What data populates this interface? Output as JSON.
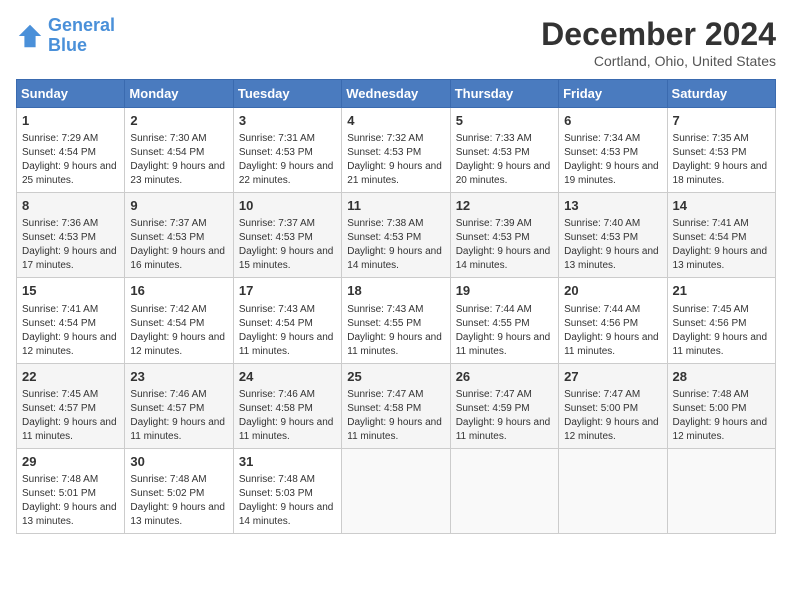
{
  "logo": {
    "line1": "General",
    "line2": "Blue"
  },
  "title": "December 2024",
  "subtitle": "Cortland, Ohio, United States",
  "days_of_week": [
    "Sunday",
    "Monday",
    "Tuesday",
    "Wednesday",
    "Thursday",
    "Friday",
    "Saturday"
  ],
  "weeks": [
    [
      {
        "day": "1",
        "sunrise": "7:29 AM",
        "sunset": "4:54 PM",
        "daylight": "9 hours and 25 minutes."
      },
      {
        "day": "2",
        "sunrise": "7:30 AM",
        "sunset": "4:54 PM",
        "daylight": "9 hours and 23 minutes."
      },
      {
        "day": "3",
        "sunrise": "7:31 AM",
        "sunset": "4:53 PM",
        "daylight": "9 hours and 22 minutes."
      },
      {
        "day": "4",
        "sunrise": "7:32 AM",
        "sunset": "4:53 PM",
        "daylight": "9 hours and 21 minutes."
      },
      {
        "day": "5",
        "sunrise": "7:33 AM",
        "sunset": "4:53 PM",
        "daylight": "9 hours and 20 minutes."
      },
      {
        "day": "6",
        "sunrise": "7:34 AM",
        "sunset": "4:53 PM",
        "daylight": "9 hours and 19 minutes."
      },
      {
        "day": "7",
        "sunrise": "7:35 AM",
        "sunset": "4:53 PM",
        "daylight": "9 hours and 18 minutes."
      }
    ],
    [
      {
        "day": "8",
        "sunrise": "7:36 AM",
        "sunset": "4:53 PM",
        "daylight": "9 hours and 17 minutes."
      },
      {
        "day": "9",
        "sunrise": "7:37 AM",
        "sunset": "4:53 PM",
        "daylight": "9 hours and 16 minutes."
      },
      {
        "day": "10",
        "sunrise": "7:37 AM",
        "sunset": "4:53 PM",
        "daylight": "9 hours and 15 minutes."
      },
      {
        "day": "11",
        "sunrise": "7:38 AM",
        "sunset": "4:53 PM",
        "daylight": "9 hours and 14 minutes."
      },
      {
        "day": "12",
        "sunrise": "7:39 AM",
        "sunset": "4:53 PM",
        "daylight": "9 hours and 14 minutes."
      },
      {
        "day": "13",
        "sunrise": "7:40 AM",
        "sunset": "4:53 PM",
        "daylight": "9 hours and 13 minutes."
      },
      {
        "day": "14",
        "sunrise": "7:41 AM",
        "sunset": "4:54 PM",
        "daylight": "9 hours and 13 minutes."
      }
    ],
    [
      {
        "day": "15",
        "sunrise": "7:41 AM",
        "sunset": "4:54 PM",
        "daylight": "9 hours and 12 minutes."
      },
      {
        "day": "16",
        "sunrise": "7:42 AM",
        "sunset": "4:54 PM",
        "daylight": "9 hours and 12 minutes."
      },
      {
        "day": "17",
        "sunrise": "7:43 AM",
        "sunset": "4:54 PM",
        "daylight": "9 hours and 11 minutes."
      },
      {
        "day": "18",
        "sunrise": "7:43 AM",
        "sunset": "4:55 PM",
        "daylight": "9 hours and 11 minutes."
      },
      {
        "day": "19",
        "sunrise": "7:44 AM",
        "sunset": "4:55 PM",
        "daylight": "9 hours and 11 minutes."
      },
      {
        "day": "20",
        "sunrise": "7:44 AM",
        "sunset": "4:56 PM",
        "daylight": "9 hours and 11 minutes."
      },
      {
        "day": "21",
        "sunrise": "7:45 AM",
        "sunset": "4:56 PM",
        "daylight": "9 hours and 11 minutes."
      }
    ],
    [
      {
        "day": "22",
        "sunrise": "7:45 AM",
        "sunset": "4:57 PM",
        "daylight": "9 hours and 11 minutes."
      },
      {
        "day": "23",
        "sunrise": "7:46 AM",
        "sunset": "4:57 PM",
        "daylight": "9 hours and 11 minutes."
      },
      {
        "day": "24",
        "sunrise": "7:46 AM",
        "sunset": "4:58 PM",
        "daylight": "9 hours and 11 minutes."
      },
      {
        "day": "25",
        "sunrise": "7:47 AM",
        "sunset": "4:58 PM",
        "daylight": "9 hours and 11 minutes."
      },
      {
        "day": "26",
        "sunrise": "7:47 AM",
        "sunset": "4:59 PM",
        "daylight": "9 hours and 11 minutes."
      },
      {
        "day": "27",
        "sunrise": "7:47 AM",
        "sunset": "5:00 PM",
        "daylight": "9 hours and 12 minutes."
      },
      {
        "day": "28",
        "sunrise": "7:48 AM",
        "sunset": "5:00 PM",
        "daylight": "9 hours and 12 minutes."
      }
    ],
    [
      {
        "day": "29",
        "sunrise": "7:48 AM",
        "sunset": "5:01 PM",
        "daylight": "9 hours and 13 minutes."
      },
      {
        "day": "30",
        "sunrise": "7:48 AM",
        "sunset": "5:02 PM",
        "daylight": "9 hours and 13 minutes."
      },
      {
        "day": "31",
        "sunrise": "7:48 AM",
        "sunset": "5:03 PM",
        "daylight": "9 hours and 14 minutes."
      },
      null,
      null,
      null,
      null
    ]
  ]
}
